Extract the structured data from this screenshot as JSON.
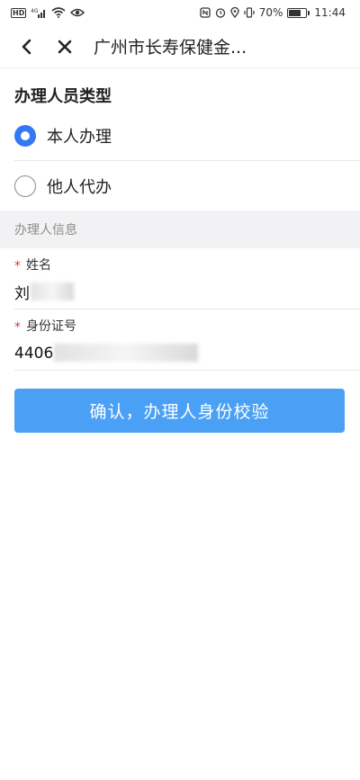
{
  "status_bar": {
    "hd_label": "HD",
    "signal_label": "4G",
    "battery_percent": "70%",
    "battery_level": 0.7,
    "time": "11:44"
  },
  "nav": {
    "back_icon": "back-arrow-icon",
    "close_icon": "close-icon",
    "title": "广州市长寿保健金..."
  },
  "handler_type": {
    "title": "办理人员类型",
    "options": [
      {
        "label": "本人办理",
        "selected": true
      },
      {
        "label": "他人代办",
        "selected": false
      }
    ]
  },
  "handler_info": {
    "section_label": "办理人信息",
    "fields": [
      {
        "required_mark": "*",
        "label": "姓名",
        "value": "刘"
      },
      {
        "required_mark": "*",
        "label": "身份证号",
        "value": "4406"
      }
    ]
  },
  "submit": {
    "label": "确认，办理人身份校验",
    "color": "#4aa0f5"
  }
}
